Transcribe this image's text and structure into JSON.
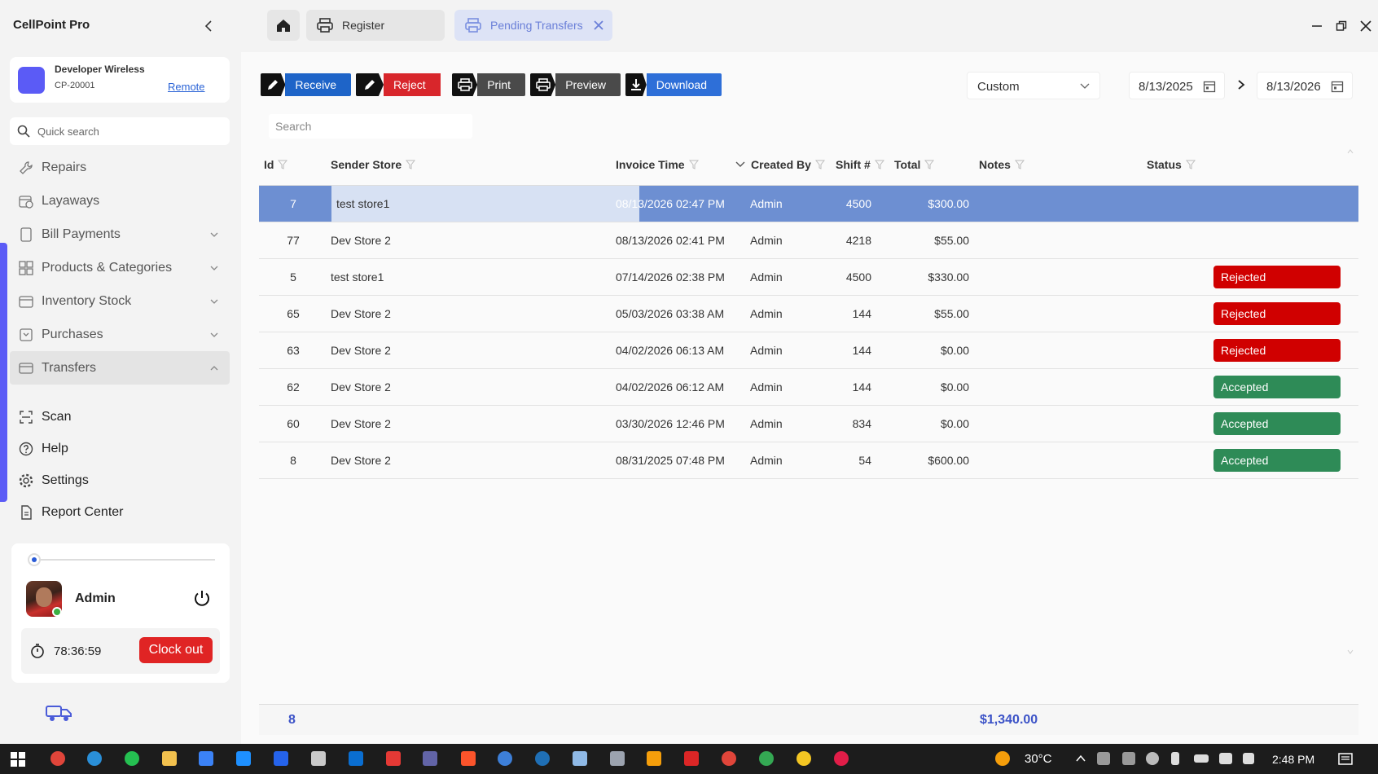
{
  "app": {
    "title": "CellPoint Pro"
  },
  "store": {
    "name": "Developer Wireless",
    "code": "CP-20001",
    "mode_link": "Remote"
  },
  "quick_search": {
    "placeholder": "Quick search"
  },
  "nav": {
    "items": [
      {
        "label": "Repairs",
        "icon": "wrench-icon",
        "expandable": false
      },
      {
        "label": "Layaways",
        "icon": "calendar-clock-icon",
        "expandable": false
      },
      {
        "label": "Bill Payments",
        "icon": "bill-icon",
        "expandable": true
      },
      {
        "label": "Products & Categories",
        "icon": "grid-icon",
        "expandable": true
      },
      {
        "label": "Inventory Stock",
        "icon": "box-icon",
        "expandable": true
      },
      {
        "label": "Purchases",
        "icon": "cart-icon",
        "expandable": true
      },
      {
        "label": "Transfers",
        "icon": "transfer-icon",
        "expandable": true,
        "expanded": true
      }
    ],
    "secondary": [
      {
        "label": "Scan",
        "icon": "scan-icon"
      },
      {
        "label": "Help",
        "icon": "help-icon"
      },
      {
        "label": "Settings",
        "icon": "gear-icon"
      },
      {
        "label": "Report Center",
        "icon": "report-icon"
      }
    ]
  },
  "user": {
    "name": "Admin",
    "timer": "78:36:59",
    "clock_out_label": "Clock out"
  },
  "tabs": [
    {
      "label": "Register",
      "icon": "printer-icon"
    },
    {
      "label": "Pending Transfers",
      "icon": "printer-icon",
      "active": true
    }
  ],
  "toolbar": {
    "receive": "Receive",
    "reject": "Reject",
    "print": "Print",
    "preview": "Preview",
    "download": "Download"
  },
  "filters": {
    "range": "Custom",
    "date_from": "8/13/2025",
    "date_to": "8/13/2026"
  },
  "grid": {
    "search_placeholder": "Search",
    "columns": [
      "Id",
      "Sender Store",
      "Invoice Time",
      "Created By",
      "Shift #",
      "Total",
      "Notes",
      "Status"
    ],
    "rows": [
      {
        "id": "7",
        "sender": "test store1",
        "time": "08/13/2026 02:47 PM",
        "by": "Admin",
        "shift": "4500",
        "total": "$300.00",
        "notes": "",
        "status": ""
      },
      {
        "id": "77",
        "sender": "Dev Store 2",
        "time": "08/13/2026 02:41 PM",
        "by": "Admin",
        "shift": "4218",
        "total": "$55.00",
        "notes": "",
        "status": ""
      },
      {
        "id": "5",
        "sender": "test store1",
        "time": "07/14/2026 02:38 PM",
        "by": "Admin",
        "shift": "4500",
        "total": "$330.00",
        "notes": "",
        "status": "Rejected"
      },
      {
        "id": "65",
        "sender": "Dev Store 2",
        "time": "05/03/2026 03:38 AM",
        "by": "Admin",
        "shift": "144",
        "total": "$55.00",
        "notes": "",
        "status": "Rejected"
      },
      {
        "id": "63",
        "sender": "Dev Store 2",
        "time": "04/02/2026 06:13 AM",
        "by": "Admin",
        "shift": "144",
        "total": "$0.00",
        "notes": "",
        "status": "Rejected"
      },
      {
        "id": "62",
        "sender": "Dev Store 2",
        "time": "04/02/2026 06:12 AM",
        "by": "Admin",
        "shift": "144",
        "total": "$0.00",
        "notes": "",
        "status": "Accepted"
      },
      {
        "id": "60",
        "sender": "Dev Store 2",
        "time": "03/30/2026 12:46 PM",
        "by": "Admin",
        "shift": "834",
        "total": "$0.00",
        "notes": "",
        "status": "Accepted"
      },
      {
        "id": "8",
        "sender": "Dev Store 2",
        "time": "08/31/2025 07:48 PM",
        "by": "Admin",
        "shift": "54",
        "total": "$600.00",
        "notes": "",
        "status": "Accepted"
      }
    ],
    "summary": {
      "count": "8",
      "total": "$1,340.00"
    }
  },
  "taskbar": {
    "temperature": "30°C",
    "time": "2:48 PM"
  },
  "colors": {
    "accent": "#5b5bf6",
    "rejected": "#d00000",
    "accepted": "#2e8b57",
    "selected_row": "#6d8fd2"
  }
}
